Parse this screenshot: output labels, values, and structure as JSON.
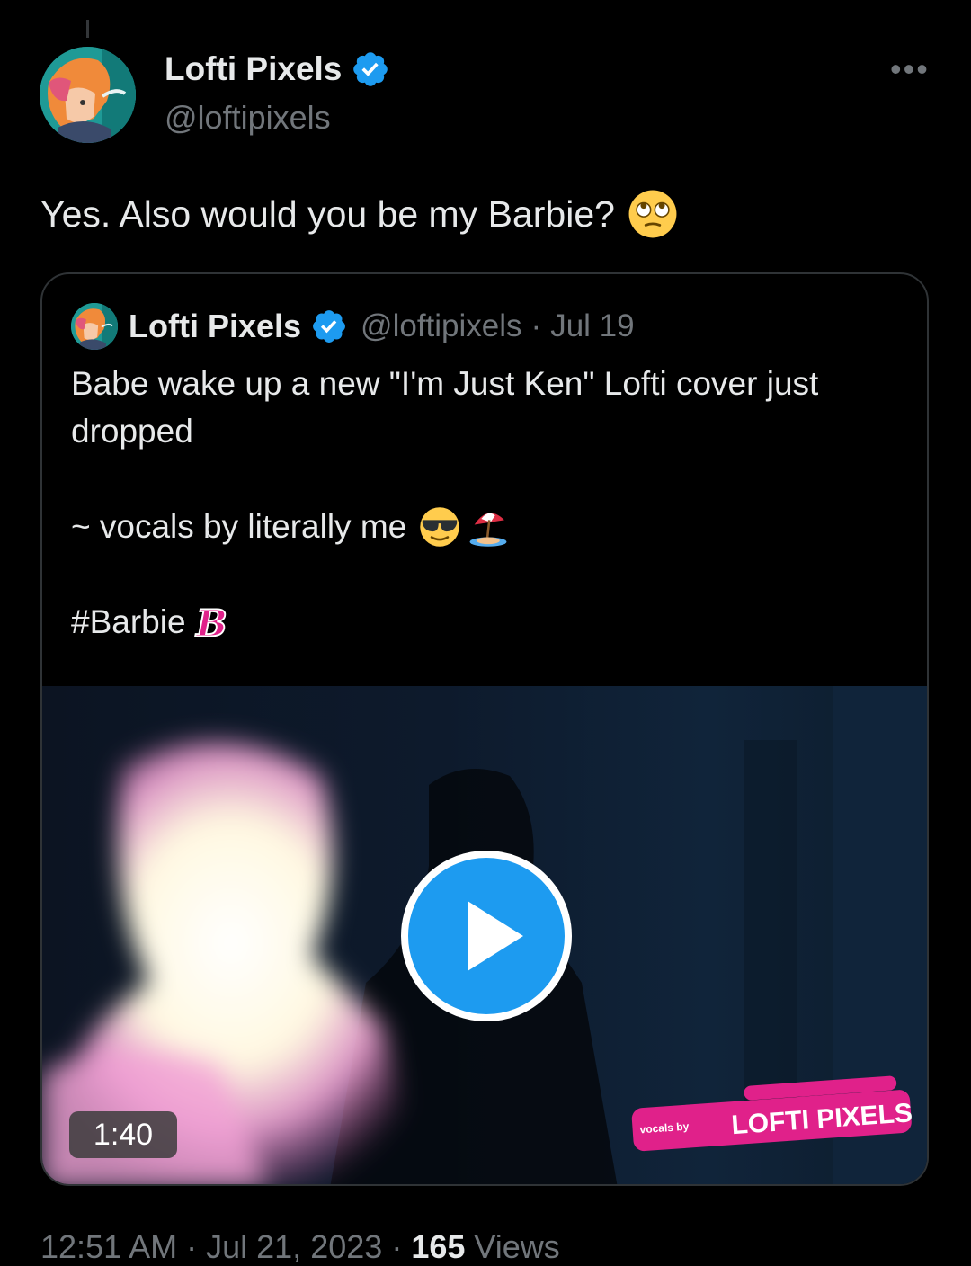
{
  "author": {
    "display_name": "Lofti Pixels",
    "handle": "@loftipixels",
    "verified": true,
    "verified_color": "#1d9bf0"
  },
  "tweet": {
    "text": "Yes. Also would you be my Barbie?",
    "emoji": "face-with-rolling-eyes"
  },
  "quoted_tweet": {
    "display_name": "Lofti Pixels",
    "handle": "@loftipixels",
    "separator": "·",
    "date": "Jul 19",
    "line1": "Babe wake up a new \"I'm Just Ken\" Lofti cover just dropped",
    "line2": "~ vocals by literally me",
    "line2_emojis": [
      "smiling-face-with-sunglasses",
      "umbrella-on-ground"
    ],
    "line3": "#Barbie",
    "line3_emoji": "barbie-b-logo",
    "media": {
      "type": "video",
      "duration": "1:40",
      "watermark_text": "LOFTI PIXELS",
      "watermark_sub": "vocals by"
    }
  },
  "meta": {
    "time": "12:51 AM",
    "separator": "·",
    "date": "Jul 21, 2023",
    "views_count": "165",
    "views_label": "Views"
  }
}
